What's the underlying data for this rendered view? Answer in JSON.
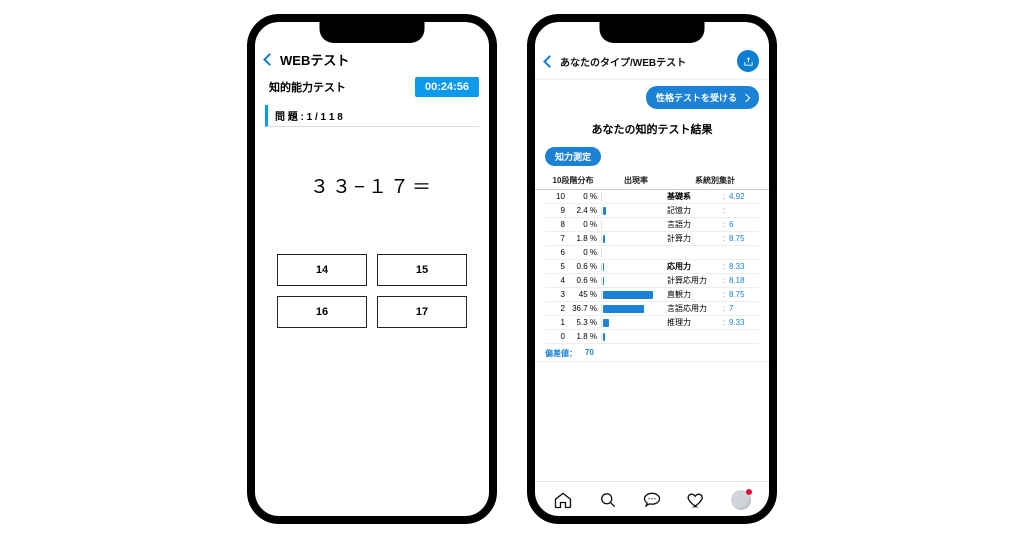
{
  "colors": {
    "accent": "#0b99eb",
    "primary": "#1c82d6"
  },
  "phone1": {
    "header": {
      "title": "WEBテスト"
    },
    "subtitle": "知的能力テスト",
    "timer": "00:24:56",
    "question_number_label": "問 題 : 1  /  1 1 8",
    "question": "３３−１７＝",
    "answers": [
      "14",
      "15",
      "16",
      "17"
    ]
  },
  "phone2": {
    "header": {
      "title": "あなたのタイプ/WEBテスト",
      "share_icon": "share-icon"
    },
    "cta": "性格テストを受ける",
    "result_title": "あなたの知的テスト結果",
    "pill": "知力測定",
    "table_headers": {
      "dist": "10段階分布",
      "rate": "出現率",
      "right": "系統別集計"
    },
    "distribution": [
      {
        "level": 10,
        "pct": "0 %",
        "bar": 0
      },
      {
        "level": 9,
        "pct": "2.4 %",
        "bar": 2.4
      },
      {
        "level": 8,
        "pct": "0 %",
        "bar": 0
      },
      {
        "level": 7,
        "pct": "1.8 %",
        "bar": 1.8
      },
      {
        "level": 6,
        "pct": "0 %",
        "bar": 0
      },
      {
        "level": 5,
        "pct": "0.6 %",
        "bar": 0.6
      },
      {
        "level": 4,
        "pct": "0.6 %",
        "bar": 0.6
      },
      {
        "level": 3,
        "pct": "45 %",
        "bar": 45
      },
      {
        "level": 2,
        "pct": "36.7 %",
        "bar": 36.7
      },
      {
        "level": 1,
        "pct": "5.3 %",
        "bar": 5.3
      },
      {
        "level": 0,
        "pct": "1.8 %",
        "bar": 1.8
      }
    ],
    "categories": [
      {
        "name": "基礎系",
        "score": "4.92",
        "bold": true
      },
      {
        "name": "記憶力",
        "score": ""
      },
      {
        "name": "言語力",
        "score": "6"
      },
      {
        "name": "計算力",
        "score": "8.75"
      },
      {
        "name": "",
        "score": ""
      },
      {
        "name": "応用力",
        "score": "8.33",
        "bold": true
      },
      {
        "name": "計算応用力",
        "score": "8.18"
      },
      {
        "name": "直観力",
        "score": "8.75"
      },
      {
        "name": "言語応用力",
        "score": "7"
      },
      {
        "name": "推理力",
        "score": "9.33"
      },
      {
        "name": "",
        "score": ""
      }
    ],
    "deviation": {
      "label": "偏差値：",
      "value": "70"
    },
    "tabs": [
      "home",
      "search",
      "chat",
      "heart",
      "avatar"
    ]
  },
  "chart_data": {
    "type": "bar",
    "title": "10段階分布 出現率",
    "categories": [
      10,
      9,
      8,
      7,
      6,
      5,
      4,
      3,
      2,
      1,
      0
    ],
    "values": [
      0,
      2.4,
      0,
      1.8,
      0,
      0.6,
      0.6,
      45,
      36.7,
      5.3,
      1.8
    ],
    "xlabel": "段階",
    "ylabel": "出現率 (%)",
    "ylim": [
      0,
      50
    ]
  }
}
